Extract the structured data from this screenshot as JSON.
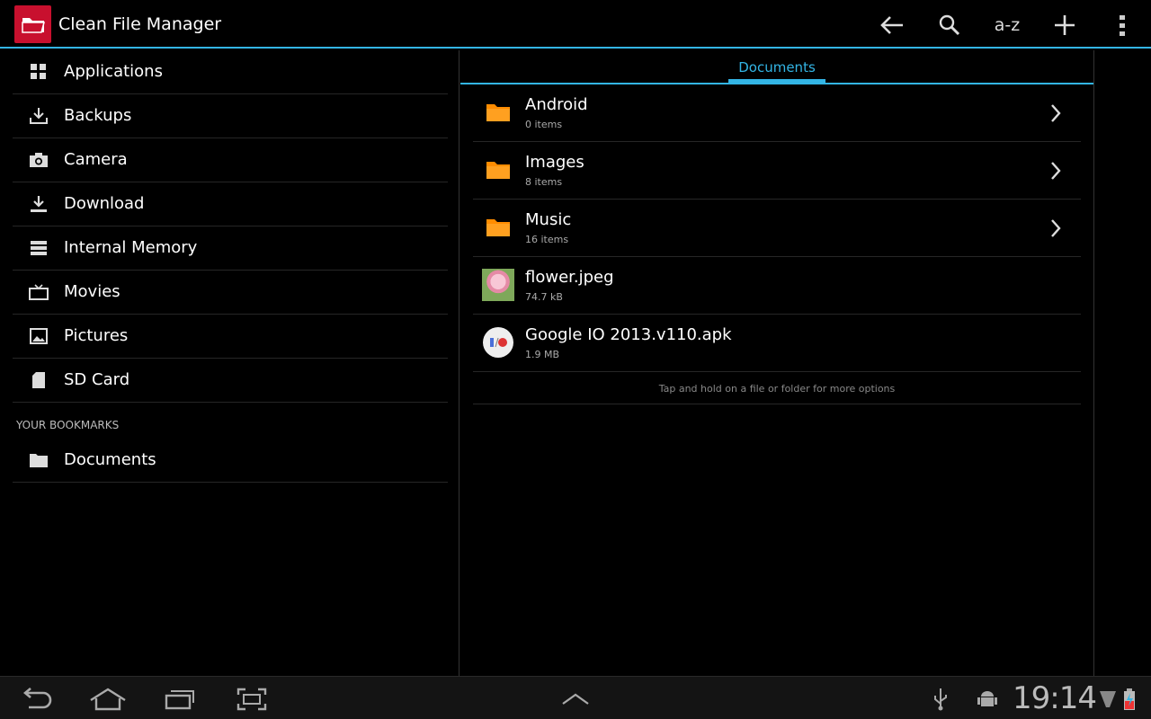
{
  "app": {
    "title": "Clean File Manager"
  },
  "toolbar": {
    "sort_label": "a-z"
  },
  "sidebar": {
    "items": [
      {
        "label": "Applications",
        "icon": "grid-icon"
      },
      {
        "label": "Backups",
        "icon": "download-tray-icon"
      },
      {
        "label": "Camera",
        "icon": "camera-icon"
      },
      {
        "label": "Download",
        "icon": "download-icon"
      },
      {
        "label": "Internal Memory",
        "icon": "storage-icon"
      },
      {
        "label": "Movies",
        "icon": "tv-icon"
      },
      {
        "label": "Pictures",
        "icon": "picture-icon"
      },
      {
        "label": "SD Card",
        "icon": "sdcard-icon"
      }
    ],
    "bookmarks_header": "YOUR BOOKMARKS",
    "bookmarks": [
      {
        "label": "Documents",
        "icon": "folder-icon"
      }
    ]
  },
  "content": {
    "breadcrumb": "Documents",
    "files": [
      {
        "name": "Android",
        "meta": "0 items",
        "type": "folder"
      },
      {
        "name": "Images",
        "meta": "8 items",
        "type": "folder"
      },
      {
        "name": "Music",
        "meta": "16 items",
        "type": "folder"
      },
      {
        "name": "flower.jpeg",
        "meta": "74.7 kB",
        "type": "image"
      },
      {
        "name": "Google IO 2013.v110.apk",
        "meta": "1.9 MB",
        "type": "apk"
      }
    ],
    "hint": "Tap and hold on a file or folder for more options"
  },
  "status": {
    "time": "19:14"
  },
  "colors": {
    "accent": "#33b5e5",
    "folder": "#ff8c00",
    "app_icon": "#c8102e"
  }
}
